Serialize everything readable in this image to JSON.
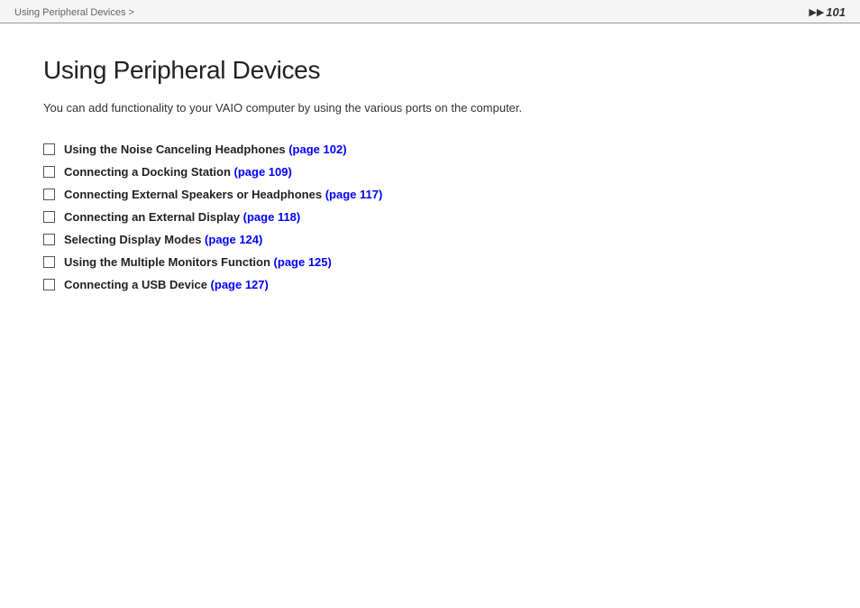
{
  "header": {
    "breadcrumb": "Using Peripheral Devices >",
    "page_number": "101",
    "arrow": "▶▶"
  },
  "main": {
    "title": "Using Peripheral Devices",
    "intro": "You can add functionality to your VAIO computer by using the various ports on the computer.",
    "toc_items": [
      {
        "label": "Using the Noise Canceling Headphones",
        "link_text": "(page 102)"
      },
      {
        "label": "Connecting a Docking Station",
        "link_text": "(page 109)"
      },
      {
        "label": "Connecting External Speakers or Headphones",
        "link_text": "(page 117)"
      },
      {
        "label": "Connecting an External Display",
        "link_text": "(page 118)"
      },
      {
        "label": "Selecting Display Modes",
        "link_text": "(page 124)"
      },
      {
        "label": "Using the Multiple Monitors Function",
        "link_text": "(page 125)"
      },
      {
        "label": "Connecting a USB Device",
        "link_text": "(page 127)"
      }
    ]
  }
}
